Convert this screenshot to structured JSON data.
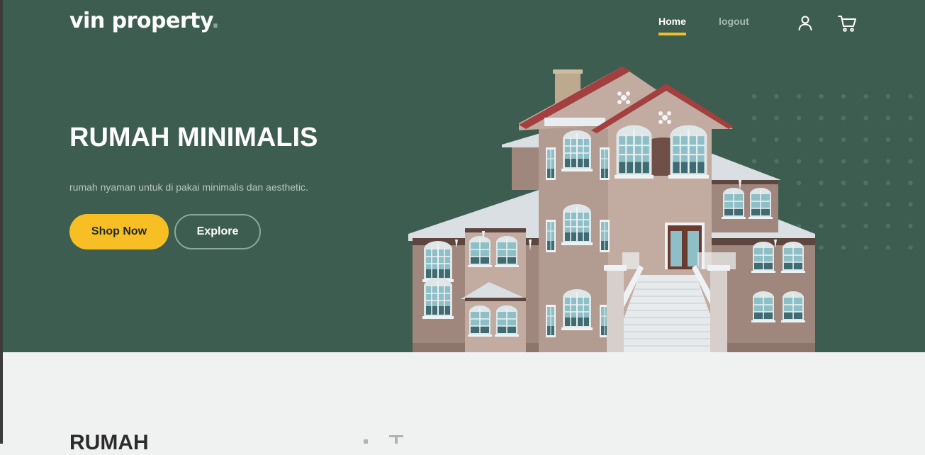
{
  "brand": {
    "name": "vin property",
    "dot": "."
  },
  "nav": {
    "items": [
      {
        "label": "Home",
        "active": true
      },
      {
        "label": "logout",
        "active": false
      }
    ],
    "icons": [
      "user-icon",
      "cart-icon"
    ]
  },
  "hero": {
    "title": "RUMAH MINIMALIS",
    "subtitle": "rumah nyaman untuk di pakai minimalis dan aesthetic.",
    "buttons": {
      "primary": "Shop Now",
      "secondary": "Explore"
    }
  },
  "next_section": {
    "heading": "RUMAH"
  },
  "colors": {
    "hero_bg": "#3d5d50",
    "accent": "#f8bf25",
    "page_bg": "#f0f2f1",
    "text_light": "#ffffff"
  }
}
